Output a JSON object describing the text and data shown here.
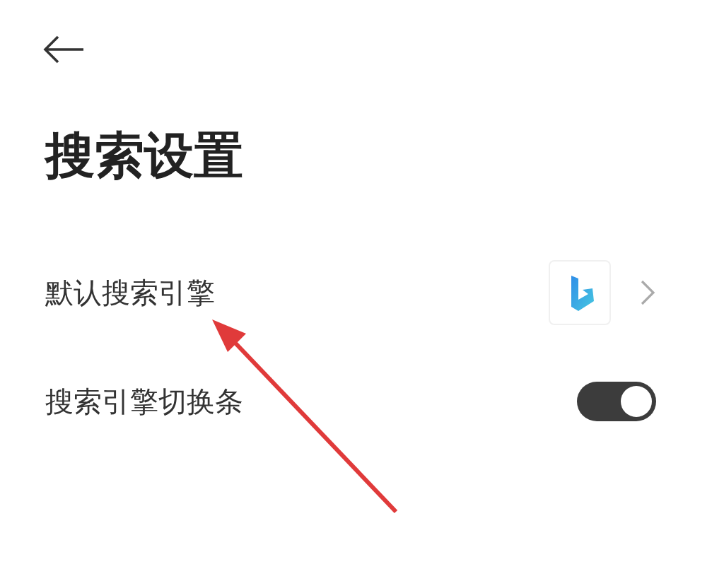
{
  "header": {
    "title": "搜索设置"
  },
  "settings": [
    {
      "kind": "link",
      "label": "默认搜索引擎"
    },
    {
      "kind": "toggle",
      "label": "搜索引擎切换条",
      "on": true
    }
  ]
}
